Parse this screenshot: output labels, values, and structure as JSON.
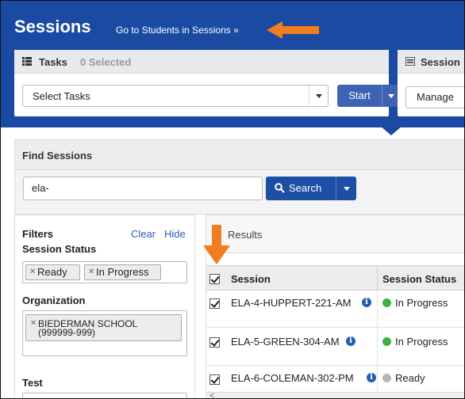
{
  "header": {
    "title": "Sessions",
    "link": "Go to Students in Sessions »"
  },
  "tasks": {
    "label": "Tasks",
    "count": "0 Selected",
    "select_value": "Select Tasks",
    "start_label": "Start"
  },
  "session": {
    "label": "Session",
    "manage_label": "Manage"
  },
  "find": {
    "label": "Find Sessions",
    "search_value": "ela-",
    "search_label": "Search"
  },
  "filters": {
    "title": "Filters",
    "clear": "Clear",
    "hide": "Hide",
    "status_label": "Session Status",
    "status_chips": [
      "Ready",
      "In Progress"
    ],
    "org_label": "Organization",
    "org_chip_line1": "BIEDERMAN SCHOOL",
    "org_chip_line2": "(999999-999)",
    "test_label": "Test"
  },
  "results": {
    "label": "Results",
    "col_session": "Session",
    "col_status": "Session Status",
    "rows": [
      {
        "name": "ELA-4-HUPPERT-221-AM",
        "status": "In Progress",
        "status_color": "#3cb043"
      },
      {
        "name": "ELA-5-GREEN-304-AM",
        "status": "In Progress",
        "status_color": "#3cb043"
      },
      {
        "name": "ELA-6-COLEMAN-302-PM",
        "status": "Ready",
        "status_color": "#b5b5b5"
      }
    ]
  },
  "colors": {
    "header_bg": "#1a4aa2",
    "primary_button": "#3f63b4",
    "search_button": "#1c4fa6",
    "link": "#2a5cb8",
    "annotation_arrow": "#f07d1e"
  },
  "icons": {
    "tasks": "list-icon",
    "session": "list-icon",
    "search": "search-icon",
    "info": "info-icon",
    "chip_remove": "close-icon"
  }
}
